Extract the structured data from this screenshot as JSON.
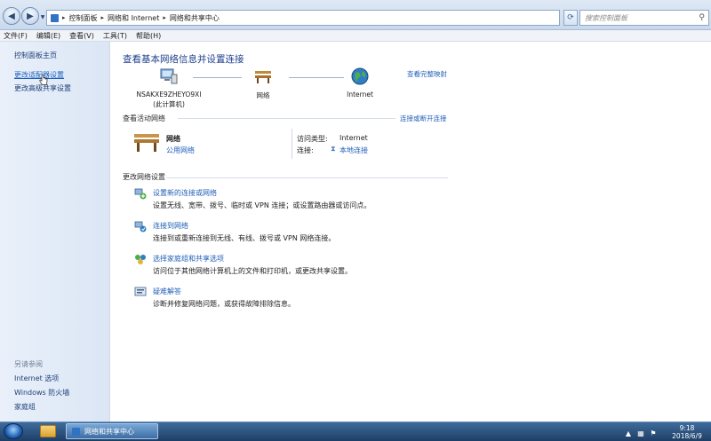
{
  "address_bar": {
    "crumbs": [
      "控制面板",
      "网络和 Internet",
      "网络和共享中心"
    ],
    "search_placeholder": "搜索控制面板"
  },
  "menu": [
    "文件(F)",
    "编辑(E)",
    "查看(V)",
    "工具(T)",
    "帮助(H)"
  ],
  "sidebar": {
    "items": [
      "控制面板主页",
      "更改适配器设置",
      "更改高级共享设置"
    ],
    "see_also_title": "另请参阅",
    "see_also": [
      "Internet 选项",
      "Windows 防火墙",
      "家庭组"
    ]
  },
  "main": {
    "title": "查看基本网络信息并设置连接",
    "full_map_link": "查看完整映射",
    "map": {
      "computer_name": "NSAKXE9ZHEYO9XI",
      "computer_sub": "(此计算机)",
      "network": "网络",
      "internet": "Internet"
    },
    "active_header": "查看活动网络",
    "connect_link": "连接或断开连接",
    "active": {
      "name": "网络",
      "type": "公用网络",
      "access_label": "访问类型:",
      "access_value": "Internet",
      "conn_label": "连接:",
      "conn_value": "本地连接"
    },
    "change_header": "更改网络设置",
    "tasks": [
      {
        "title": "设置新的连接或网络",
        "desc": "设置无线、宽带、拨号、临时或 VPN 连接；或设置路由器或访问点。",
        "icon": "network-setup-icon"
      },
      {
        "title": "连接到网络",
        "desc": "连接到或重新连接到无线、有线、拨号或 VPN 网络连接。",
        "icon": "connect-network-icon"
      },
      {
        "title": "选择家庭组和共享选项",
        "desc": "访问位于其他网络计算机上的文件和打印机，或更改共享设置。",
        "icon": "homegroup-icon"
      },
      {
        "title": "疑难解答",
        "desc": "诊断并修复网络问题，或获得故障排除信息。",
        "icon": "troubleshoot-icon"
      }
    ]
  },
  "taskbar": {
    "window_label": "网络和共享中心",
    "time": "9:18",
    "date": "2018/6/9"
  }
}
